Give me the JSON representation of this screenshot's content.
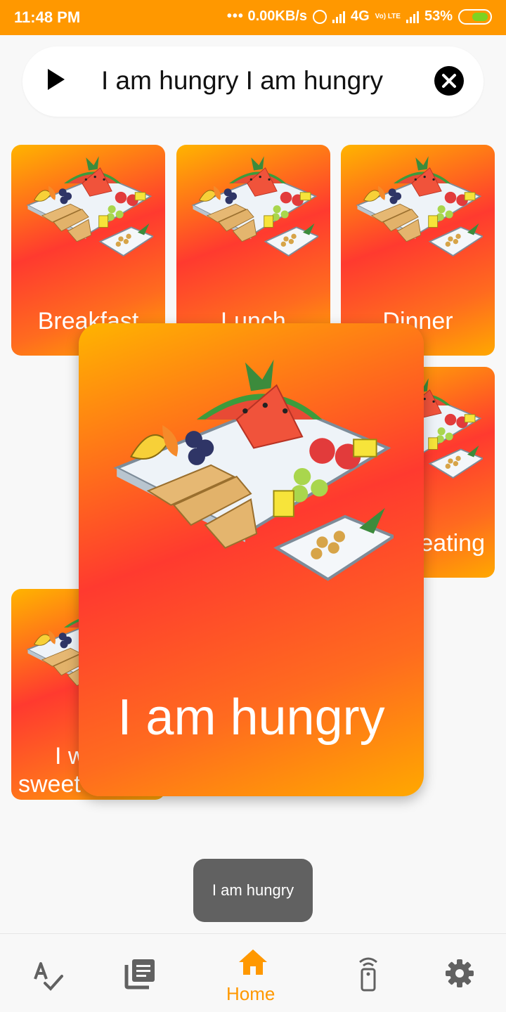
{
  "status_bar": {
    "time": "11:48 PM",
    "network_speed": "0.00KB/s",
    "network_type": "4G",
    "volte": "Vo) LTE",
    "battery": "53%"
  },
  "sentence_bar": {
    "text": "I am hungry I am hungry"
  },
  "cards": [
    {
      "label": "Breakfast"
    },
    {
      "label": "Lunch"
    },
    {
      "label": "Dinner"
    },
    {
      "label": "eating"
    },
    {
      "label_line1": "I w",
      "label_line2": "sweet"
    }
  ],
  "focused_card": {
    "label": "I am hungry"
  },
  "toast": {
    "text": "I am hungry"
  },
  "bottom_nav": {
    "items": [
      {
        "icon": "spellcheck-icon"
      },
      {
        "icon": "library-books-icon"
      },
      {
        "icon": "home-icon",
        "label": "Home",
        "active": true
      },
      {
        "icon": "remote-icon"
      },
      {
        "icon": "gear-icon"
      }
    ]
  },
  "colors": {
    "accent": "#ff9800",
    "card_gradient": [
      "#ffb400",
      "#ff3a2f",
      "#ffa800"
    ],
    "toast": "#616161"
  }
}
